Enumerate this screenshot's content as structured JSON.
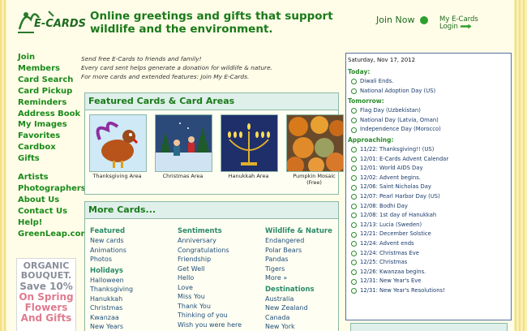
{
  "header": {
    "brand": "E-CARDS",
    "tagline": "Online greetings and gifts that support wildlife and the environment.",
    "join_now": "Join Now",
    "my_ecards": [
      "My E-Cards",
      "Login"
    ]
  },
  "nav": {
    "group1": [
      "Join",
      "Members",
      "Card Search",
      "Card Pickup",
      "Reminders",
      "Address Book",
      "My Images",
      "Favorites",
      "Cardbox",
      "Gifts"
    ],
    "group2": [
      "Artists",
      "Photographers",
      "About Us",
      "Contact Us",
      "Help!",
      "GreenLeap.com"
    ]
  },
  "ad": {
    "line1": "ORGANIC",
    "line2": "BOUQUET.",
    "line3": "Save 10%",
    "line4": "On Spring",
    "line5": "Flowers",
    "line6": "And Gifts"
  },
  "intro": [
    "Send free E-Cards to friends and family!",
    "Every card sent helps generate a donation for wildlife & nature.",
    "For more cards and extended features: Join My E-Cards."
  ],
  "featured": {
    "title": "Featured Cards & Card Areas",
    "cards": [
      {
        "caption": "Thanksgiving Area"
      },
      {
        "caption": "Christmas Area"
      },
      {
        "caption": "Hanukkah Area"
      },
      {
        "caption": "Pumpkin Mosaic (Free)"
      }
    ]
  },
  "more": {
    "title": "More Cards...",
    "columns": [
      [
        {
          "h": "Featured"
        },
        {
          "i": "New cards"
        },
        {
          "i": "Animations"
        },
        {
          "i": "Photos"
        },
        {
          "h": "Holidays"
        },
        {
          "i": "Halloween"
        },
        {
          "i": "Thanksgiving"
        },
        {
          "i": "Hanukkah"
        },
        {
          "i": "Christmas"
        },
        {
          "i": "Kwanzaa"
        },
        {
          "i": "New Years"
        }
      ],
      [
        {
          "h": "Sentiments"
        },
        {
          "i": "Anniversary"
        },
        {
          "i": "Congratulations"
        },
        {
          "i": "Friendship"
        },
        {
          "i": "Get Well"
        },
        {
          "i": "Hello"
        },
        {
          "i": "Love"
        },
        {
          "i": "Miss You"
        },
        {
          "i": "Thank You"
        },
        {
          "i": "Thinking of you"
        },
        {
          "i": "Wish you were here"
        }
      ],
      [
        {
          "h": "Wildlife & Nature"
        },
        {
          "i": "Endangered"
        },
        {
          "i": "Polar Bears"
        },
        {
          "i": "Pandas"
        },
        {
          "i": "Tigers"
        },
        {
          "i": "More »"
        },
        {
          "h": "Destinations"
        },
        {
          "i": "Australia"
        },
        {
          "i": "New Zealand"
        },
        {
          "i": "Canada"
        },
        {
          "i": "New York"
        }
      ]
    ]
  },
  "calendar": {
    "date": "Saturday, Nov 17, 2012",
    "today_label": "Today:",
    "today": [
      "Diwali Ends.",
      "National Adoption Day (US)"
    ],
    "tomorrow_label": "Tomorrow:",
    "tomorrow": [
      "Flag Day (Uzbekistan)",
      "National Day (Latvia, Oman)",
      "Independence Day (Morocco)"
    ],
    "approaching_label": "Approaching:",
    "approaching": [
      "11/22: Thanksgiving!! (US)",
      "12/01: E-Cards Advent Calendar",
      "12/01: World AIDS Day",
      "12/02: Advent begins.",
      "12/06: Saint Nicholas Day",
      "12/07: Pearl Harbor Day (US)",
      "12/08: Bodhi Day",
      "12/08: 1st day of Hanukkah",
      "12/13: Lucia (Sweden)",
      "12/21: December Solstice",
      "12/24: Advent ends",
      "12/24: Christmas Eve",
      "12/25: Christmas",
      "12/26: Kwanzaa begins.",
      "12/31: New Year's Eve",
      "12/31: New Year's Resolutions!"
    ]
  },
  "colors": {
    "accent": "#1a7a1a",
    "link": "#1f4f7a",
    "calendar_border": "#556fa0",
    "panel_head": "#dff0ea"
  }
}
